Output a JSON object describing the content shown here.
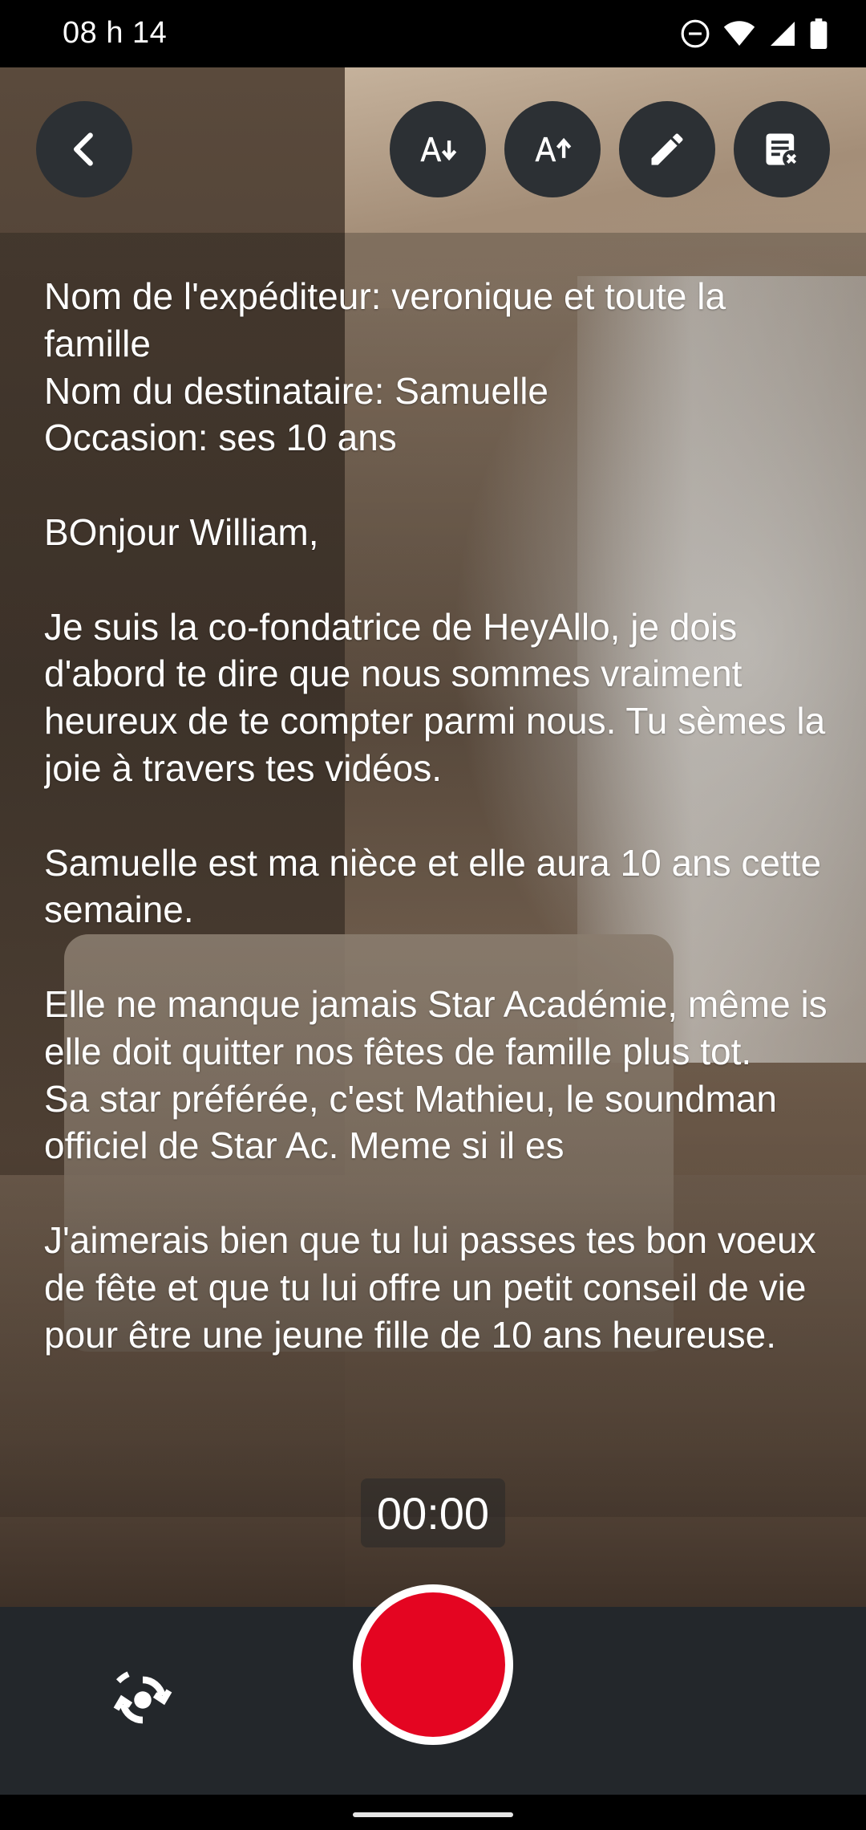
{
  "status_bar": {
    "time": "08 h 14",
    "icons": [
      "do-not-disturb-icon",
      "wifi-icon",
      "signal-icon",
      "battery-icon"
    ]
  },
  "toolbar": {
    "back": "back-arrow-icon",
    "decrease_text": "text-size-decrease-icon",
    "increase_text": "text-size-increase-icon",
    "edit": "edit-pencil-icon",
    "clear": "clear-script-icon"
  },
  "script": {
    "lines": [
      "Nom de l'expéditeur: veronique et toute la famille",
      "Nom du destinataire: Samuelle",
      "Occasion: ses 10 ans",
      "",
      "BOnjour William,",
      "",
      "Je suis la co-fondatrice de HeyAllo, je dois d'abord te dire que nous sommes vraiment heureux de te compter parmi nous. Tu sèmes la joie à travers tes vidéos.",
      "",
      "Samuelle est ma nièce et elle aura 10 ans cette semaine.",
      "",
      "Elle ne manque jamais Star Académie, même is elle doit quitter nos fêtes de famille plus tot.",
      "Sa star préférée, c'est Mathieu, le soundman officiel de Star Ac. Meme si il es",
      "",
      "J'aimerais bien que tu lui passes tes bon voeux de fête et que tu lui offre un petit conseil de vie pour être une jeune fille de 10 ans heureuse."
    ]
  },
  "timer": "00:00",
  "bottom": {
    "flip_camera": "switch-camera-icon",
    "record": "record-button"
  },
  "colors": {
    "record": "#e40521",
    "bar": "#23272b",
    "button": "#2c3034"
  }
}
